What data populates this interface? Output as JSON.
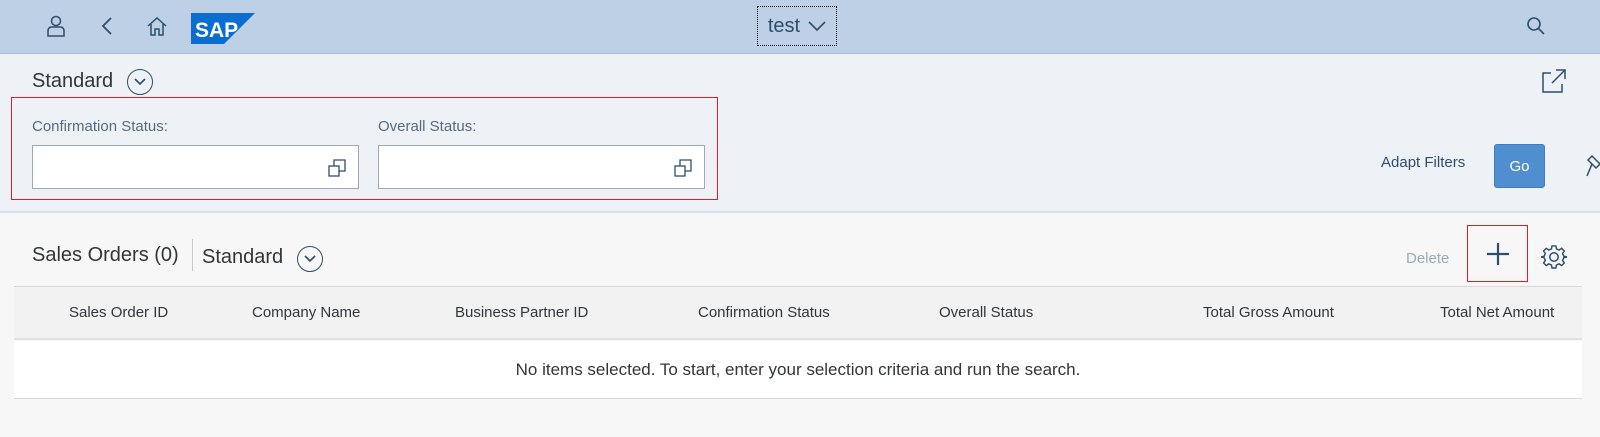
{
  "shell": {
    "app_title": "test",
    "logo_text": "SAP",
    "icons": [
      "user-icon",
      "back-icon",
      "home-icon",
      "search-icon"
    ]
  },
  "filter_bar": {
    "variant": "Standard",
    "filters": [
      {
        "label": "Confirmation Status:",
        "value": ""
      },
      {
        "label": "Overall Status:",
        "value": ""
      }
    ],
    "adapt_filters_label": "Adapt Filters",
    "go_label": "Go"
  },
  "table": {
    "title": "Sales Orders (0)",
    "variant": "Standard",
    "delete_label": "Delete",
    "columns": [
      "Sales Order ID",
      "Company Name",
      "Business Partner ID",
      "Confirmation Status",
      "Overall Status",
      "Total Gross Amount",
      "Total Net Amount"
    ],
    "no_data_text": "No items selected. To start, enter your selection criteria and run the search."
  },
  "colors": {
    "shell_bg": "#bdd0e6",
    "accent": "#2c4e6c",
    "go_button": "#4f8fcf",
    "highlight_border": "#d8222a"
  }
}
